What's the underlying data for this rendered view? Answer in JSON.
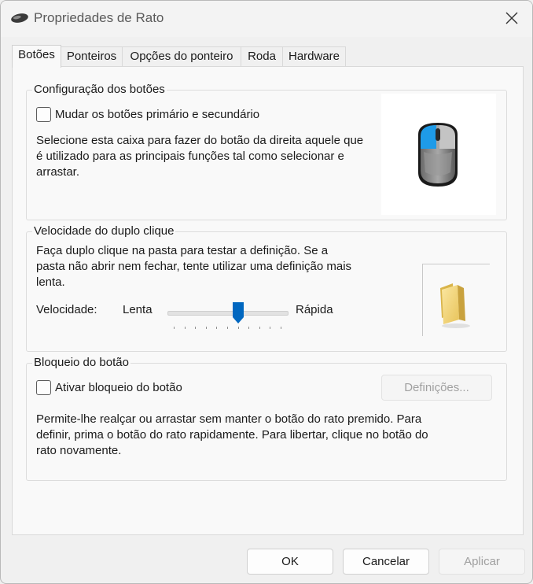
{
  "window": {
    "title": "Propriedades de Rato",
    "close_icon": "close-icon",
    "app_icon": "mouse-icon"
  },
  "tabs": [
    {
      "label": "Botões",
      "active": true
    },
    {
      "label": "Ponteiros",
      "active": false
    },
    {
      "label": "Opções do ponteiro",
      "active": false
    },
    {
      "label": "Roda",
      "active": false
    },
    {
      "label": "Hardware",
      "active": false
    }
  ],
  "button_config": {
    "legend": "Configuração dos botões",
    "checkbox_label": "Mudar os botões primário e secundário",
    "checked": false,
    "description": "Selecione esta caixa para fazer do botão da direita aquele que é utilizado para as principais funções tal como selecionar e arrastar.",
    "illustration_icon": "mouse-icon"
  },
  "double_click": {
    "legend": "Velocidade do duplo clique",
    "description": "Faça duplo clique na pasta para testar a definição. Se a pasta não abrir nem fechar, tente utilizar uma definição mais lenta.",
    "speed_label": "Velocidade:",
    "slow_label": "Lenta",
    "fast_label": "Rápida",
    "speed_value": 0.6,
    "test_icon": "folder-icon"
  },
  "click_lock": {
    "legend": "Bloqueio do botão",
    "checkbox_label": "Ativar bloqueio do botão",
    "checked": false,
    "settings_button": "Definições...",
    "description": "Permite-lhe realçar ou arrastar sem manter o botão do rato premido. Para definir, prima o botão do rato rapidamente. Para libertar, clique no botão do rato novamente."
  },
  "footer": {
    "ok": "OK",
    "cancel": "Cancelar",
    "apply": "Aplicar"
  },
  "colors": {
    "accent": "#0067c0",
    "mouse_button_highlight": "#1e9be8"
  }
}
